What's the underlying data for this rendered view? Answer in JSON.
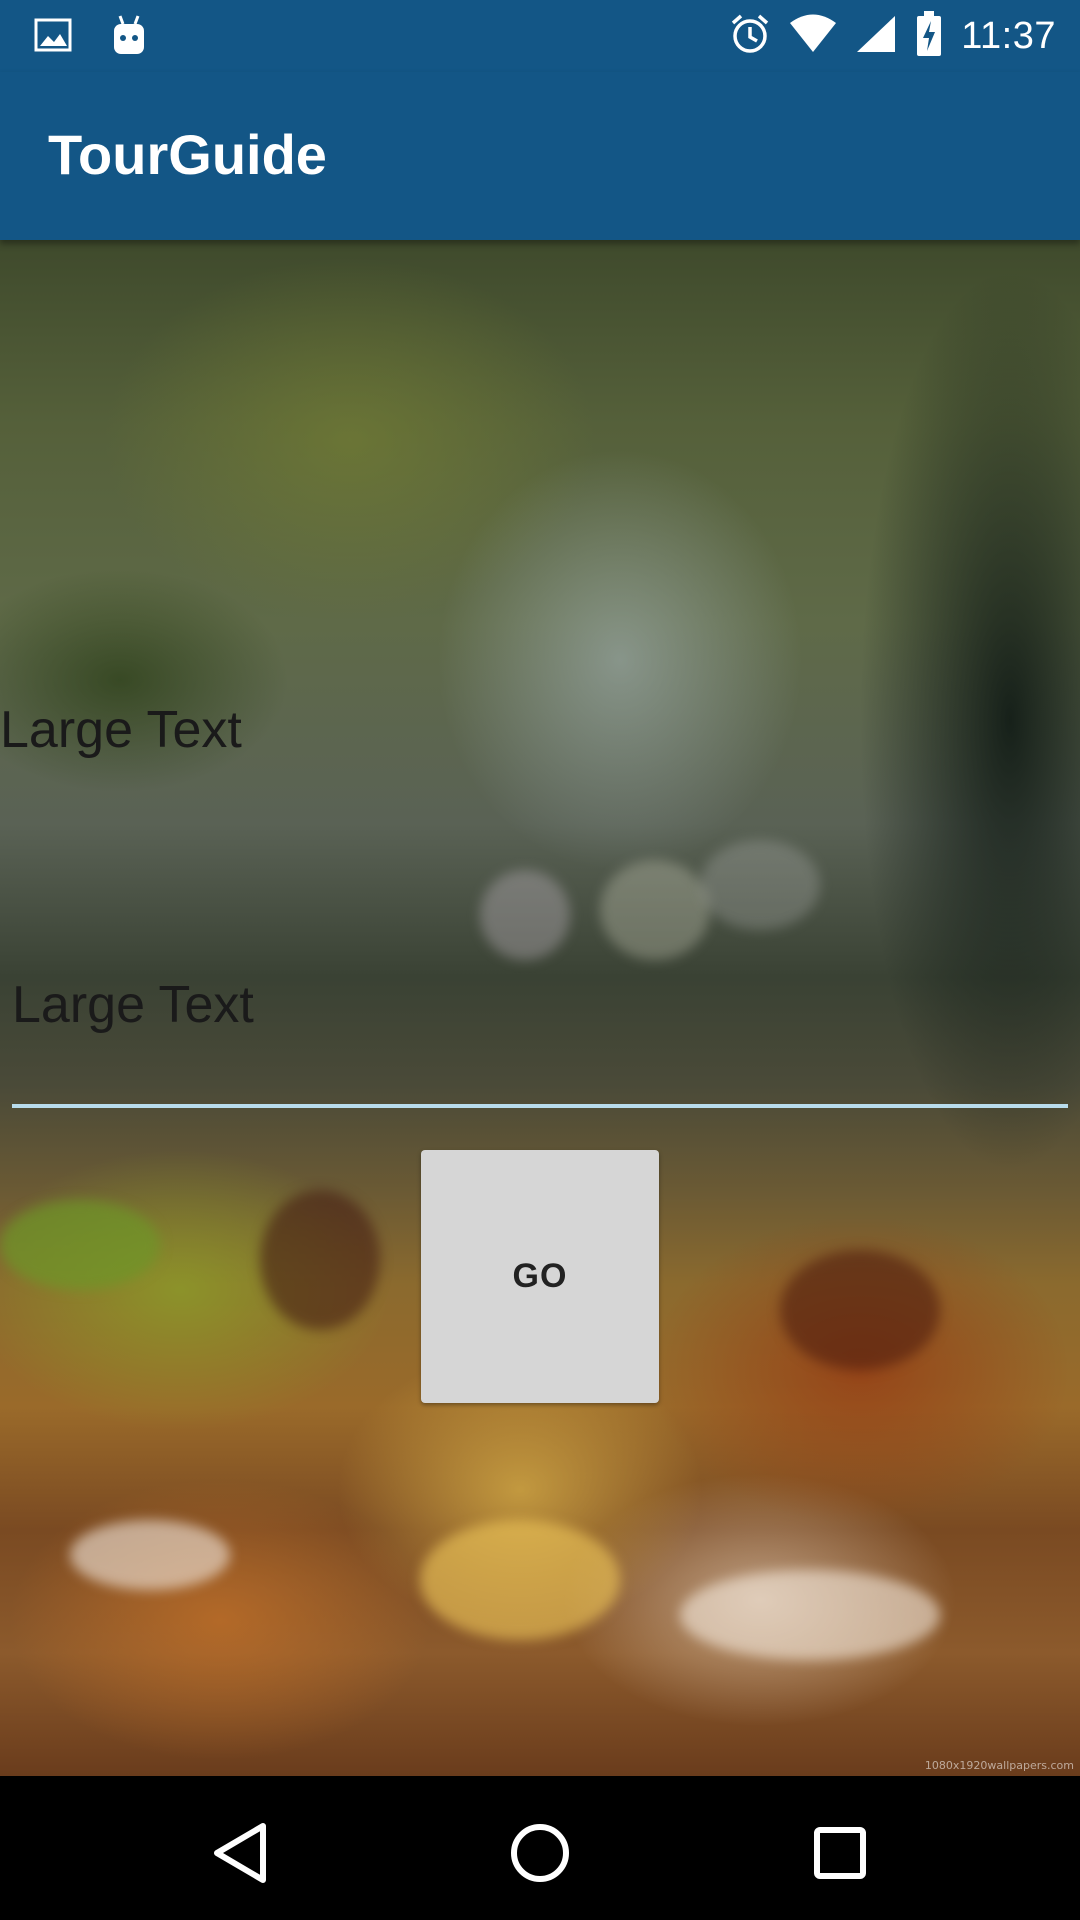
{
  "status_bar": {
    "time": "11:37",
    "icons": [
      "image-icon",
      "android-icon",
      "alarm-icon",
      "wifi-icon",
      "signal-icon",
      "battery-charging-icon"
    ]
  },
  "app_bar": {
    "title": "TourGuide",
    "color": "#135686"
  },
  "content": {
    "large_text_1": "Large Text",
    "large_text_2": "Large Text",
    "go_button_label": "GO",
    "watermark": "1080x1920wallpapers.com"
  },
  "nav_bar": {
    "buttons": [
      "back-icon",
      "home-icon",
      "recents-icon"
    ]
  }
}
